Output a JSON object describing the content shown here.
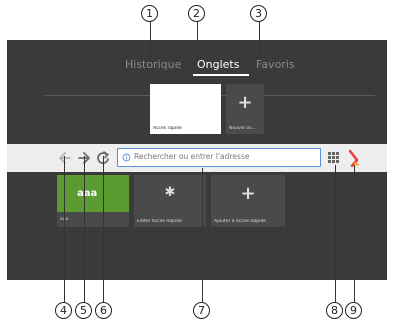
{
  "callouts": [
    "1",
    "2",
    "3",
    "4",
    "5",
    "6",
    "7",
    "8",
    "9"
  ],
  "tabs": [
    {
      "label": "Historique",
      "active": false
    },
    {
      "label": "Onglets",
      "active": true
    },
    {
      "label": "Favoris",
      "active": false
    }
  ],
  "top_tiles": [
    {
      "label": "Accès rapide",
      "kind": "white"
    },
    {
      "label": "Nouvel on...",
      "kind": "add"
    }
  ],
  "toolbar": {
    "back_icon": "back-arrow-icon",
    "forward_icon": "forward-arrow-icon",
    "reload_icon": "reload-icon",
    "search_placeholder": "Rechercher ou entrer l'adresse",
    "grid_icon": "apps-grid-icon",
    "logo_icon": "browser-logo-icon"
  },
  "speed_dial": [
    {
      "title": "aaa",
      "label": "aaa",
      "color": "#5c9a32"
    },
    {
      "label": "Éditer Accès Rapide",
      "icon": "gear-icon"
    },
    {
      "label": "Ajouter à Accès Rapide",
      "icon": "plus-icon"
    }
  ],
  "colors": {
    "background": "#3a3a3c",
    "toolbar": "#eeeeee",
    "search_border": "#5a8ed6",
    "tile_green": "#5c9a32",
    "logo_red": "#e8423b",
    "logo_orange": "#f5a623"
  }
}
